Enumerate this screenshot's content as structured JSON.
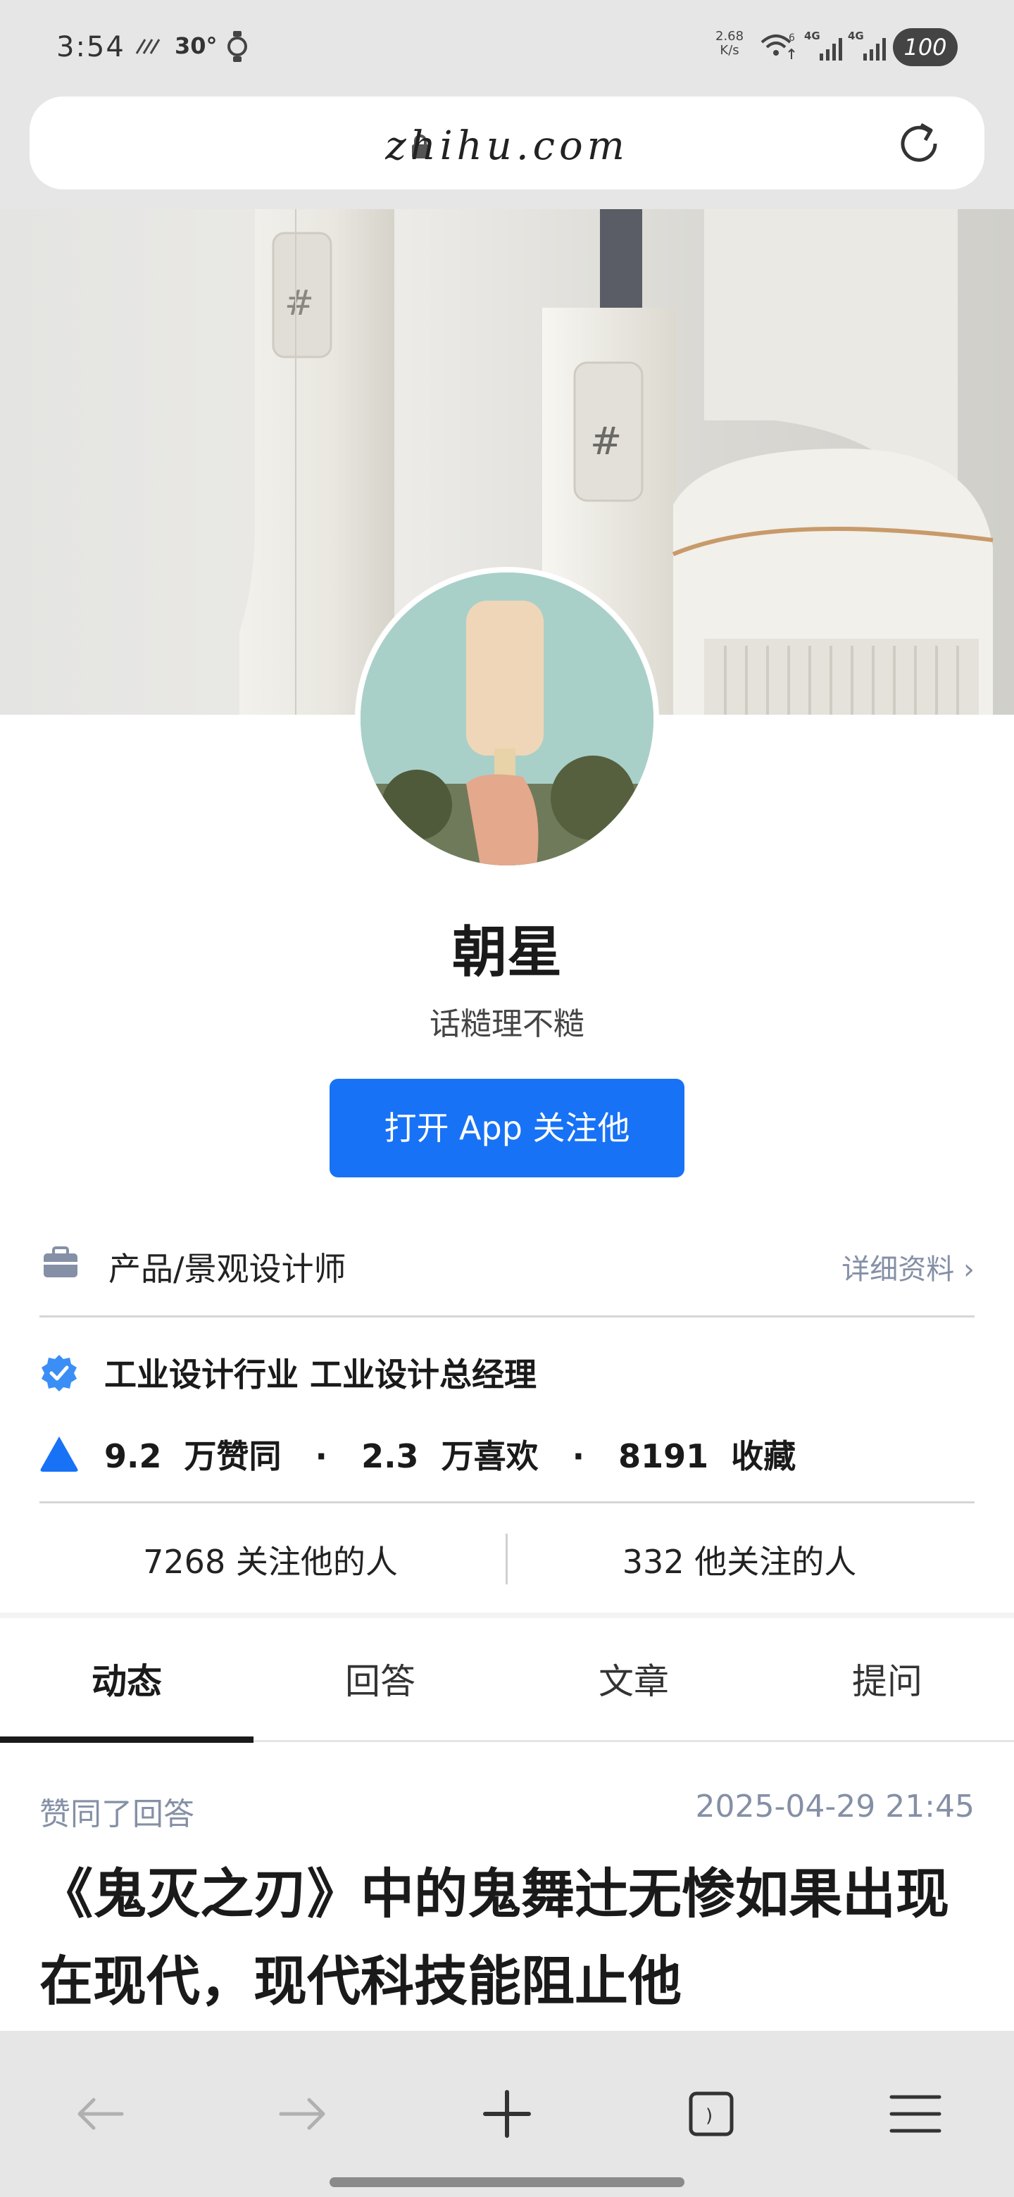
{
  "status_bar": {
    "time": "3:54",
    "temperature": "30°",
    "net_speed_value": "2.68",
    "net_speed_unit": "K/s",
    "battery": "100"
  },
  "browser": {
    "url": "zhihu.com"
  },
  "profile": {
    "name": "朝星",
    "headline": "话糙理不糙",
    "follow_button": "打开  App  关注他",
    "occupation": "产品/景观设计师",
    "detail_link": "详细资料  ›",
    "verification": "工业设计行业  工业设计总经理",
    "stats": "9.2  万赞同   ·   2.3  万喜欢   ·   8191  收藏",
    "followers": "7268  关注他的人",
    "following": "332  他关注的人"
  },
  "tabs": [
    "动态",
    "回答",
    "文章",
    "提问"
  ],
  "active_tab": "动态",
  "feed": {
    "action": "赞同了回答",
    "timestamp": "2025-04-29  21:45",
    "title": "《鬼灭之刃》中的鬼舞辻无惨如果出现在现代，现代科技能阻止他"
  },
  "colors": {
    "accent": "#1772f6",
    "muted_text": "#8590a6",
    "verified_blue": "#3a8ef6"
  },
  "icons": [
    "lock-icon",
    "reload-icon",
    "briefcase-icon",
    "verified-badge-icon",
    "upvote-triangle-icon",
    "back-arrow-icon",
    "forward-arrow-icon",
    "new-tab-plus-icon",
    "tabs-icon",
    "menu-icon"
  ]
}
